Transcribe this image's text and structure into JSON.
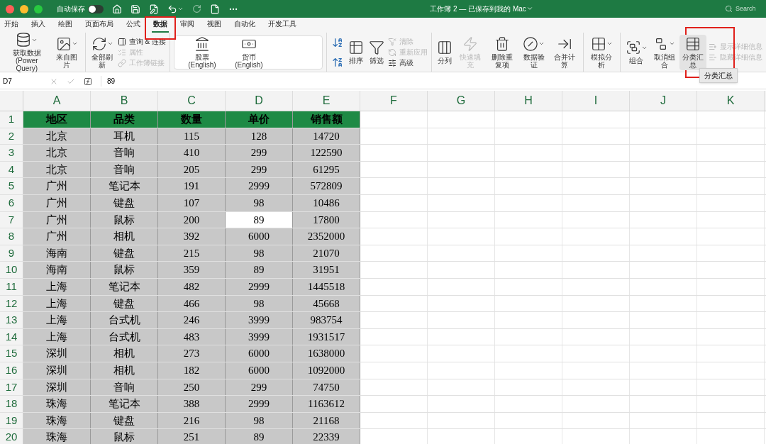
{
  "titlebar": {
    "autosave_label": "自动保存",
    "autosave_on": false,
    "title": "工作簿 2 — 已保存到我的 Mac",
    "search_placeholder": "Search"
  },
  "tabs": [
    {
      "label": "开始",
      "selected": false
    },
    {
      "label": "插入",
      "selected": false
    },
    {
      "label": "绘图",
      "selected": false
    },
    {
      "label": "页面布局",
      "selected": false
    },
    {
      "label": "公式",
      "selected": false
    },
    {
      "label": "数据",
      "selected": true,
      "highlighted": true
    },
    {
      "label": "审阅",
      "selected": false
    },
    {
      "label": "视图",
      "selected": false
    },
    {
      "label": "自动化",
      "selected": false
    },
    {
      "label": "开发工具",
      "selected": false
    }
  ],
  "ribbon": [
    {
      "kind": "plain",
      "items": [
        {
          "kind": "large",
          "label": "获取数据 (Power Query)",
          "disabled": false,
          "dropdown": true
        },
        {
          "kind": "large",
          "label": "来自图片",
          "disabled": false,
          "dropdown": true
        }
      ]
    },
    {
      "kind": "plain",
      "items": [
        {
          "kind": "large",
          "label": "全部刷新",
          "disabled": false,
          "dropdown": true
        },
        {
          "kind": "small",
          "label": "查询 & 连接",
          "disabled": false
        },
        {
          "kind": "small",
          "label": "属性",
          "disabled": true
        },
        {
          "kind": "small",
          "label": "工作簿链接",
          "disabled": true
        }
      ]
    },
    {
      "kind": "panel",
      "items": [
        {
          "kind": "large",
          "label": "股票 (English)",
          "disabled": false,
          "dropdown": false
        },
        {
          "kind": "large",
          "label": "货币 (English)",
          "disabled": false,
          "dropdown": false
        }
      ]
    },
    {
      "kind": "plain",
      "items": [
        {
          "kind": "icon"
        },
        {
          "kind": "large",
          "label": "排序",
          "disabled": false,
          "dropdown": false
        },
        {
          "kind": "large",
          "label": "筛选",
          "disabled": false,
          "dropdown": false
        },
        {
          "kind": "small",
          "label": "清除",
          "disabled": true
        },
        {
          "kind": "small",
          "label": "重新应用",
          "disabled": true
        },
        {
          "kind": "small",
          "label": "高级",
          "disabled": false
        }
      ]
    },
    {
      "kind": "plain",
      "items": [
        {
          "kind": "large",
          "label": "分列",
          "disabled": false,
          "dropdown": false
        },
        {
          "kind": "large",
          "label": "快速填充",
          "disabled": true,
          "dropdown": false
        },
        {
          "kind": "large",
          "label": "删除重复项",
          "disabled": false,
          "dropdown": false
        },
        {
          "kind": "large",
          "label": "数据验证",
          "disabled": false,
          "dropdown": true
        },
        {
          "kind": "large",
          "label": "合并计算",
          "disabled": false,
          "dropdown": false
        }
      ]
    },
    {
      "kind": "plain",
      "items": [
        {
          "kind": "large",
          "label": "模拟分析",
          "disabled": false,
          "dropdown": true
        }
      ]
    },
    {
      "kind": "plain",
      "items": [
        {
          "kind": "large",
          "label": "组合",
          "disabled": false,
          "dropdown": true
        },
        {
          "kind": "large",
          "label": "取消组合",
          "disabled": false,
          "dropdown": true
        },
        {
          "kind": "large",
          "label": "分类汇总",
          "disabled": false,
          "dropdown": false,
          "highlighted": true
        },
        {
          "kind": "small",
          "label": "显示详细信息",
          "disabled": true
        },
        {
          "kind": "small",
          "label": "隐藏详细信息",
          "disabled": true
        }
      ]
    }
  ],
  "tooltip": "分类汇总",
  "formula_bar": {
    "name_box": "D7",
    "formula": "89"
  },
  "columns": [
    "A",
    "B",
    "C",
    "D",
    "E",
    "F",
    "G",
    "H",
    "I",
    "J",
    "K"
  ],
  "rows": [
    {
      "number": "1",
      "header": true,
      "cells": [
        {
          "text": "地区",
          "selected": false
        },
        {
          "text": "品类",
          "selected": false
        },
        {
          "text": "数量",
          "selected": false
        },
        {
          "text": "单价",
          "selected": false
        },
        {
          "text": "销售额",
          "selected": false
        }
      ]
    },
    {
      "number": "2",
      "header": false,
      "cells": [
        {
          "text": "北京",
          "selected": false
        },
        {
          "text": "耳机",
          "selected": false
        },
        {
          "text": "115",
          "selected": false
        },
        {
          "text": "128",
          "selected": false
        },
        {
          "text": "14720",
          "selected": false
        }
      ]
    },
    {
      "number": "3",
      "header": false,
      "cells": [
        {
          "text": "北京",
          "selected": false
        },
        {
          "text": "音响",
          "selected": false
        },
        {
          "text": "410",
          "selected": false
        },
        {
          "text": "299",
          "selected": false
        },
        {
          "text": "122590",
          "selected": false
        }
      ]
    },
    {
      "number": "4",
      "header": false,
      "cells": [
        {
          "text": "北京",
          "selected": false
        },
        {
          "text": "音响",
          "selected": false
        },
        {
          "text": "205",
          "selected": false
        },
        {
          "text": "299",
          "selected": false
        },
        {
          "text": "61295",
          "selected": false
        }
      ]
    },
    {
      "number": "5",
      "header": false,
      "cells": [
        {
          "text": "广州",
          "selected": false
        },
        {
          "text": "笔记本",
          "selected": false
        },
        {
          "text": "191",
          "selected": false
        },
        {
          "text": "2999",
          "selected": false
        },
        {
          "text": "572809",
          "selected": false
        }
      ]
    },
    {
      "number": "6",
      "header": false,
      "cells": [
        {
          "text": "广州",
          "selected": false
        },
        {
          "text": "键盘",
          "selected": false
        },
        {
          "text": "107",
          "selected": false
        },
        {
          "text": "98",
          "selected": false
        },
        {
          "text": "10486",
          "selected": false
        }
      ]
    },
    {
      "number": "7",
      "header": false,
      "cells": [
        {
          "text": "广州",
          "selected": false
        },
        {
          "text": "鼠标",
          "selected": false
        },
        {
          "text": "200",
          "selected": false
        },
        {
          "text": "89",
          "selected": true
        },
        {
          "text": "17800",
          "selected": false
        }
      ]
    },
    {
      "number": "8",
      "header": false,
      "cells": [
        {
          "text": "广州",
          "selected": false
        },
        {
          "text": "相机",
          "selected": false
        },
        {
          "text": "392",
          "selected": false
        },
        {
          "text": "6000",
          "selected": false
        },
        {
          "text": "2352000",
          "selected": false
        }
      ]
    },
    {
      "number": "9",
      "header": false,
      "cells": [
        {
          "text": "海南",
          "selected": false
        },
        {
          "text": "键盘",
          "selected": false
        },
        {
          "text": "215",
          "selected": false
        },
        {
          "text": "98",
          "selected": false
        },
        {
          "text": "21070",
          "selected": false
        }
      ]
    },
    {
      "number": "10",
      "header": false,
      "cells": [
        {
          "text": "海南",
          "selected": false
        },
        {
          "text": "鼠标",
          "selected": false
        },
        {
          "text": "359",
          "selected": false
        },
        {
          "text": "89",
          "selected": false
        },
        {
          "text": "31951",
          "selected": false
        }
      ]
    },
    {
      "number": "11",
      "header": false,
      "cells": [
        {
          "text": "上海",
          "selected": false
        },
        {
          "text": "笔记本",
          "selected": false
        },
        {
          "text": "482",
          "selected": false
        },
        {
          "text": "2999",
          "selected": false
        },
        {
          "text": "1445518",
          "selected": false
        }
      ]
    },
    {
      "number": "12",
      "header": false,
      "cells": [
        {
          "text": "上海",
          "selected": false
        },
        {
          "text": "键盘",
          "selected": false
        },
        {
          "text": "466",
          "selected": false
        },
        {
          "text": "98",
          "selected": false
        },
        {
          "text": "45668",
          "selected": false
        }
      ]
    },
    {
      "number": "13",
      "header": false,
      "cells": [
        {
          "text": "上海",
          "selected": false
        },
        {
          "text": "台式机",
          "selected": false
        },
        {
          "text": "246",
          "selected": false
        },
        {
          "text": "3999",
          "selected": false
        },
        {
          "text": "983754",
          "selected": false
        }
      ]
    },
    {
      "number": "14",
      "header": false,
      "cells": [
        {
          "text": "上海",
          "selected": false
        },
        {
          "text": "台式机",
          "selected": false
        },
        {
          "text": "483",
          "selected": false
        },
        {
          "text": "3999",
          "selected": false
        },
        {
          "text": "1931517",
          "selected": false
        }
      ]
    },
    {
      "number": "15",
      "header": false,
      "cells": [
        {
          "text": "深圳",
          "selected": false
        },
        {
          "text": "相机",
          "selected": false
        },
        {
          "text": "273",
          "selected": false
        },
        {
          "text": "6000",
          "selected": false
        },
        {
          "text": "1638000",
          "selected": false
        }
      ]
    },
    {
      "number": "16",
      "header": false,
      "cells": [
        {
          "text": "深圳",
          "selected": false
        },
        {
          "text": "相机",
          "selected": false
        },
        {
          "text": "182",
          "selected": false
        },
        {
          "text": "6000",
          "selected": false
        },
        {
          "text": "1092000",
          "selected": false
        }
      ]
    },
    {
      "number": "17",
      "header": false,
      "cells": [
        {
          "text": "深圳",
          "selected": false
        },
        {
          "text": "音响",
          "selected": false
        },
        {
          "text": "250",
          "selected": false
        },
        {
          "text": "299",
          "selected": false
        },
        {
          "text": "74750",
          "selected": false
        }
      ]
    },
    {
      "number": "18",
      "header": false,
      "cells": [
        {
          "text": "珠海",
          "selected": false
        },
        {
          "text": "笔记本",
          "selected": false
        },
        {
          "text": "388",
          "selected": false
        },
        {
          "text": "2999",
          "selected": false
        },
        {
          "text": "1163612",
          "selected": false
        }
      ]
    },
    {
      "number": "19",
      "header": false,
      "cells": [
        {
          "text": "珠海",
          "selected": false
        },
        {
          "text": "键盘",
          "selected": false
        },
        {
          "text": "216",
          "selected": false
        },
        {
          "text": "98",
          "selected": false
        },
        {
          "text": "21168",
          "selected": false
        }
      ]
    },
    {
      "number": "20",
      "header": false,
      "cells": [
        {
          "text": "珠海",
          "selected": false
        },
        {
          "text": "鼠标",
          "selected": false
        },
        {
          "text": "251",
          "selected": false
        },
        {
          "text": "89",
          "selected": false
        },
        {
          "text": "22339",
          "selected": false
        }
      ]
    }
  ]
}
